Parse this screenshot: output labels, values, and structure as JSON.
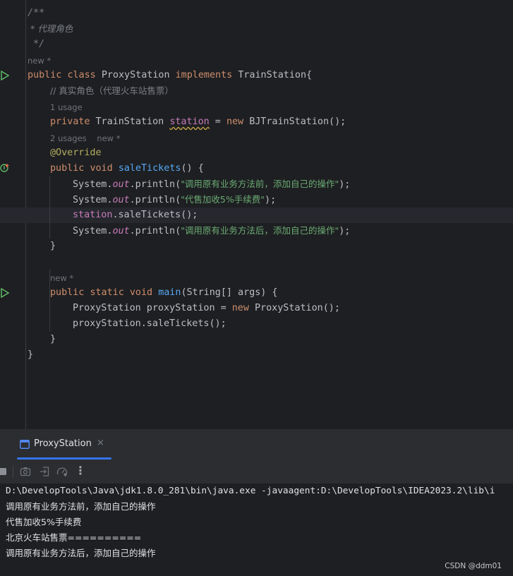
{
  "editor": {
    "doc_comment": [
      "/**",
      " * 代理角色",
      " */"
    ],
    "hint_new_class": "new *",
    "class_decl": {
      "kw_public": "public",
      "kw_class": "class",
      "name": "ProxyStation",
      "kw_implements": "implements",
      "iface": "TrainStation{"
    },
    "line_comment": "// 真实角色（代理火车站售票）",
    "hint_usage_1": "1 usage",
    "field_decl": {
      "kw_private": "private",
      "type": "TrainStation",
      "name": "station",
      "eq": " = ",
      "kw_new": "new",
      "ctor": "BJTrainStation();"
    },
    "hint_usages_2": "2 usages",
    "hint_new_method": "new *",
    "annotation": "@Override",
    "method_decl": {
      "kw_public": "public",
      "kw_void": "void",
      "name": "saleTickets",
      "rest": "() {"
    },
    "body": [
      {
        "prefix": "System.",
        "field": "out",
        "call": ".println(",
        "str": "\"调用原有业务方法前，添加自己的操作\"",
        "end": ");"
      },
      {
        "prefix": "System.",
        "field": "out",
        "call": ".println(",
        "str": "\"代售加收5%手续费\"",
        "end": ");"
      },
      {
        "field_call": "station",
        "rest": ".saleTickets();"
      },
      {
        "prefix": "System.",
        "field": "out",
        "call": ".println(",
        "str": "\"调用原有业务方法后，添加自己的操作\"",
        "end": ");"
      }
    ],
    "close_brace": "}",
    "hint_new_main": "new *",
    "main_decl": {
      "kw_public": "public",
      "kw_static": "static",
      "kw_void": "void",
      "name": "main",
      "rest": "(String[] args) {"
    },
    "main_body": [
      {
        "type": "ProxyStation",
        "var": " proxyStation = ",
        "kw_new": "new",
        "ctor": " ProxyStation();"
      },
      {
        "text": "proxyStation.saleTickets();"
      }
    ],
    "close_method": "}",
    "close_class": "}"
  },
  "run_panel": {
    "tab_label": "ProxyStation",
    "tab_close": "×",
    "toolbar_icons": [
      "stop-icon",
      "camera-icon",
      "login-icon",
      "gauge-icon",
      "more-icon"
    ],
    "toolbar_more": "⋮",
    "console_lines": [
      "D:\\DevelopTools\\Java\\jdk1.8.0_281\\bin\\java.exe -javaagent:D:\\DevelopTools\\IDEA2023.2\\lib\\i",
      "调用原有业务方法前，添加自己的操作",
      "代售加收5%手续费",
      "北京火车站售票==========",
      "调用原有业务方法后，添加自己的操作"
    ]
  },
  "watermark": "CSDN @ddm01",
  "colors": {
    "background": "#1e1f22",
    "keyword": "#cf8e6d",
    "string": "#6aab73",
    "function": "#56a8f5",
    "field": "#c77dbb",
    "annotation": "#b3ae60",
    "accent": "#3574f0"
  }
}
